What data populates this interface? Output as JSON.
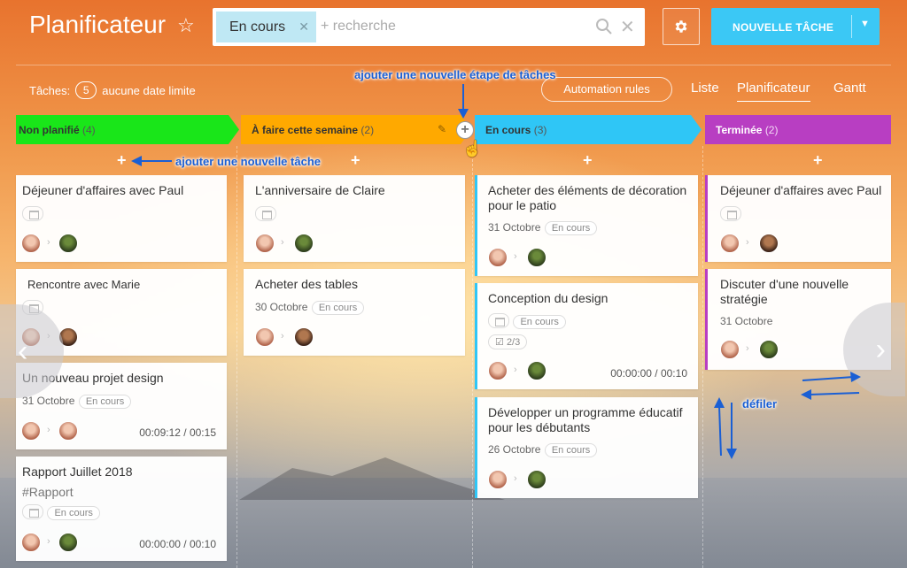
{
  "header": {
    "title": "Planificateur",
    "filter_chip": "En cours",
    "search_placeholder": "+ recherche",
    "new_task_label": "NOUVELLE TÂCHE"
  },
  "toolbar": {
    "tasks_label": "Tâches:",
    "tasks_count": "5",
    "no_deadline": "aucune date limite",
    "automation": "Automation rules",
    "views": [
      "Liste",
      "Planificateur",
      "Gantt"
    ],
    "active_view": "Planificateur"
  },
  "stages": [
    {
      "name": "Non planifié",
      "count": "(4)",
      "color": "#19e619"
    },
    {
      "name": "À faire cette semaine",
      "count": "(2)",
      "color": "#ffa900"
    },
    {
      "name": "En cours",
      "count": "(3)",
      "color": "#2fc6f6"
    },
    {
      "name": "Terminée",
      "count": "(2)",
      "color": "#b83ec2"
    }
  ],
  "cards": {
    "col1": [
      {
        "title": "Déjeuner d'affaires avec Paul"
      },
      {
        "title": "Rencontre avec Marie"
      },
      {
        "title": "Un nouveau projet design",
        "date": "31 Octobre",
        "tag": "En cours",
        "timer": "00:09:12 / 00:15"
      },
      {
        "title": "Rapport Juillet 2018",
        "hashtag": "#Rapport",
        "tag": "En cours",
        "timer": "00:00:00 / 00:10"
      }
    ],
    "col2": [
      {
        "title": "L'anniversaire de Claire"
      },
      {
        "title": "Acheter des tables",
        "date": "30 Octobre",
        "tag": "En cours"
      }
    ],
    "col3": [
      {
        "title": "Acheter des éléments de décoration pour le patio",
        "date": "31 Octobre",
        "tag": "En cours"
      },
      {
        "title": "Conception du design",
        "tag": "En cours",
        "checklist": "2/3",
        "timer": "00:00:00 / 00:10"
      },
      {
        "title": "Développer un programme éducatif pour les débutants",
        "date": "26 Octobre",
        "tag": "En cours"
      }
    ],
    "col4": [
      {
        "title": "Déjeuner d'affaires avec Paul"
      },
      {
        "title": "Discuter d'une nouvelle stratégie",
        "date": "31 Octobre"
      }
    ]
  },
  "annotations": {
    "add_stage": "ajouter une nouvelle étape de tâches",
    "add_task": "ajouter une nouvelle tâche",
    "scroll": "défiler"
  },
  "colors": {
    "accent": "#3bc8f5",
    "annotation": "#1a5fd4"
  }
}
